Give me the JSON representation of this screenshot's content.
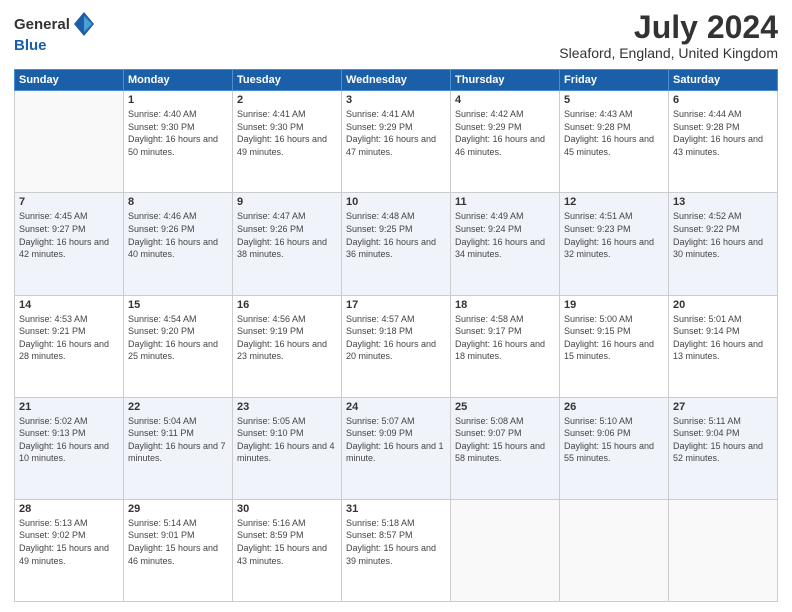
{
  "logo": {
    "general": "General",
    "blue": "Blue"
  },
  "title": "July 2024",
  "location": "Sleaford, England, United Kingdom",
  "days_of_week": [
    "Sunday",
    "Monday",
    "Tuesday",
    "Wednesday",
    "Thursday",
    "Friday",
    "Saturday"
  ],
  "weeks": [
    {
      "shaded": false,
      "days": [
        {
          "number": "",
          "sunrise": "",
          "sunset": "",
          "daylight": ""
        },
        {
          "number": "1",
          "sunrise": "Sunrise: 4:40 AM",
          "sunset": "Sunset: 9:30 PM",
          "daylight": "Daylight: 16 hours and 50 minutes."
        },
        {
          "number": "2",
          "sunrise": "Sunrise: 4:41 AM",
          "sunset": "Sunset: 9:30 PM",
          "daylight": "Daylight: 16 hours and 49 minutes."
        },
        {
          "number": "3",
          "sunrise": "Sunrise: 4:41 AM",
          "sunset": "Sunset: 9:29 PM",
          "daylight": "Daylight: 16 hours and 47 minutes."
        },
        {
          "number": "4",
          "sunrise": "Sunrise: 4:42 AM",
          "sunset": "Sunset: 9:29 PM",
          "daylight": "Daylight: 16 hours and 46 minutes."
        },
        {
          "number": "5",
          "sunrise": "Sunrise: 4:43 AM",
          "sunset": "Sunset: 9:28 PM",
          "daylight": "Daylight: 16 hours and 45 minutes."
        },
        {
          "number": "6",
          "sunrise": "Sunrise: 4:44 AM",
          "sunset": "Sunset: 9:28 PM",
          "daylight": "Daylight: 16 hours and 43 minutes."
        }
      ]
    },
    {
      "shaded": true,
      "days": [
        {
          "number": "7",
          "sunrise": "Sunrise: 4:45 AM",
          "sunset": "Sunset: 9:27 PM",
          "daylight": "Daylight: 16 hours and 42 minutes."
        },
        {
          "number": "8",
          "sunrise": "Sunrise: 4:46 AM",
          "sunset": "Sunset: 9:26 PM",
          "daylight": "Daylight: 16 hours and 40 minutes."
        },
        {
          "number": "9",
          "sunrise": "Sunrise: 4:47 AM",
          "sunset": "Sunset: 9:26 PM",
          "daylight": "Daylight: 16 hours and 38 minutes."
        },
        {
          "number": "10",
          "sunrise": "Sunrise: 4:48 AM",
          "sunset": "Sunset: 9:25 PM",
          "daylight": "Daylight: 16 hours and 36 minutes."
        },
        {
          "number": "11",
          "sunrise": "Sunrise: 4:49 AM",
          "sunset": "Sunset: 9:24 PM",
          "daylight": "Daylight: 16 hours and 34 minutes."
        },
        {
          "number": "12",
          "sunrise": "Sunrise: 4:51 AM",
          "sunset": "Sunset: 9:23 PM",
          "daylight": "Daylight: 16 hours and 32 minutes."
        },
        {
          "number": "13",
          "sunrise": "Sunrise: 4:52 AM",
          "sunset": "Sunset: 9:22 PM",
          "daylight": "Daylight: 16 hours and 30 minutes."
        }
      ]
    },
    {
      "shaded": false,
      "days": [
        {
          "number": "14",
          "sunrise": "Sunrise: 4:53 AM",
          "sunset": "Sunset: 9:21 PM",
          "daylight": "Daylight: 16 hours and 28 minutes."
        },
        {
          "number": "15",
          "sunrise": "Sunrise: 4:54 AM",
          "sunset": "Sunset: 9:20 PM",
          "daylight": "Daylight: 16 hours and 25 minutes."
        },
        {
          "number": "16",
          "sunrise": "Sunrise: 4:56 AM",
          "sunset": "Sunset: 9:19 PM",
          "daylight": "Daylight: 16 hours and 23 minutes."
        },
        {
          "number": "17",
          "sunrise": "Sunrise: 4:57 AM",
          "sunset": "Sunset: 9:18 PM",
          "daylight": "Daylight: 16 hours and 20 minutes."
        },
        {
          "number": "18",
          "sunrise": "Sunrise: 4:58 AM",
          "sunset": "Sunset: 9:17 PM",
          "daylight": "Daylight: 16 hours and 18 minutes."
        },
        {
          "number": "19",
          "sunrise": "Sunrise: 5:00 AM",
          "sunset": "Sunset: 9:15 PM",
          "daylight": "Daylight: 16 hours and 15 minutes."
        },
        {
          "number": "20",
          "sunrise": "Sunrise: 5:01 AM",
          "sunset": "Sunset: 9:14 PM",
          "daylight": "Daylight: 16 hours and 13 minutes."
        }
      ]
    },
    {
      "shaded": true,
      "days": [
        {
          "number": "21",
          "sunrise": "Sunrise: 5:02 AM",
          "sunset": "Sunset: 9:13 PM",
          "daylight": "Daylight: 16 hours and 10 minutes."
        },
        {
          "number": "22",
          "sunrise": "Sunrise: 5:04 AM",
          "sunset": "Sunset: 9:11 PM",
          "daylight": "Daylight: 16 hours and 7 minutes."
        },
        {
          "number": "23",
          "sunrise": "Sunrise: 5:05 AM",
          "sunset": "Sunset: 9:10 PM",
          "daylight": "Daylight: 16 hours and 4 minutes."
        },
        {
          "number": "24",
          "sunrise": "Sunrise: 5:07 AM",
          "sunset": "Sunset: 9:09 PM",
          "daylight": "Daylight: 16 hours and 1 minute."
        },
        {
          "number": "25",
          "sunrise": "Sunrise: 5:08 AM",
          "sunset": "Sunset: 9:07 PM",
          "daylight": "Daylight: 15 hours and 58 minutes."
        },
        {
          "number": "26",
          "sunrise": "Sunrise: 5:10 AM",
          "sunset": "Sunset: 9:06 PM",
          "daylight": "Daylight: 15 hours and 55 minutes."
        },
        {
          "number": "27",
          "sunrise": "Sunrise: 5:11 AM",
          "sunset": "Sunset: 9:04 PM",
          "daylight": "Daylight: 15 hours and 52 minutes."
        }
      ]
    },
    {
      "shaded": false,
      "days": [
        {
          "number": "28",
          "sunrise": "Sunrise: 5:13 AM",
          "sunset": "Sunset: 9:02 PM",
          "daylight": "Daylight: 15 hours and 49 minutes."
        },
        {
          "number": "29",
          "sunrise": "Sunrise: 5:14 AM",
          "sunset": "Sunset: 9:01 PM",
          "daylight": "Daylight: 15 hours and 46 minutes."
        },
        {
          "number": "30",
          "sunrise": "Sunrise: 5:16 AM",
          "sunset": "Sunset: 8:59 PM",
          "daylight": "Daylight: 15 hours and 43 minutes."
        },
        {
          "number": "31",
          "sunrise": "Sunrise: 5:18 AM",
          "sunset": "Sunset: 8:57 PM",
          "daylight": "Daylight: 15 hours and 39 minutes."
        },
        {
          "number": "",
          "sunrise": "",
          "sunset": "",
          "daylight": ""
        },
        {
          "number": "",
          "sunrise": "",
          "sunset": "",
          "daylight": ""
        },
        {
          "number": "",
          "sunrise": "",
          "sunset": "",
          "daylight": ""
        }
      ]
    }
  ]
}
